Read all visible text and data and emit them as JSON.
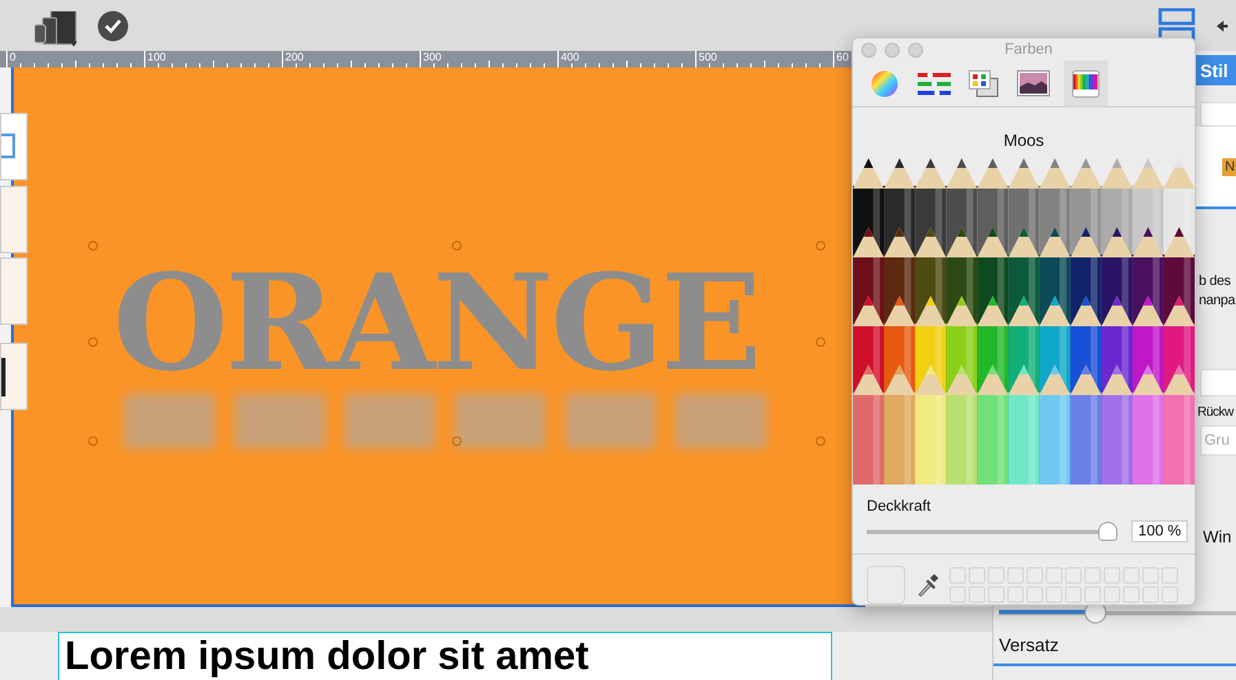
{
  "ruler": {
    "labels": [
      "0",
      "100",
      "200",
      "300",
      "400",
      "500",
      "60"
    ]
  },
  "canvas": {
    "headline": "ORANGE",
    "text_frame": "Lorem ipsum dolor sit amet"
  },
  "color_panel": {
    "title": "Farben",
    "modes": [
      {
        "kind": "wheel",
        "selected": false
      },
      {
        "kind": "sliders",
        "selected": false
      },
      {
        "kind": "palettes",
        "selected": false
      },
      {
        "kind": "image",
        "selected": false
      },
      {
        "kind": "pencils",
        "selected": true
      }
    ],
    "color_name": "Moos",
    "opacity": {
      "label": "Deckkraft",
      "level": 1,
      "reading": "100 %"
    }
  },
  "inspector": {
    "tab": "Stil",
    "tag": "N",
    "lines": [
      "b des",
      "nanpa"
    ],
    "label_1": "Rückw",
    "button": "Gru",
    "label_2": "Win",
    "slider": {
      "level": 0.4
    },
    "label_3": "Versatz"
  }
}
